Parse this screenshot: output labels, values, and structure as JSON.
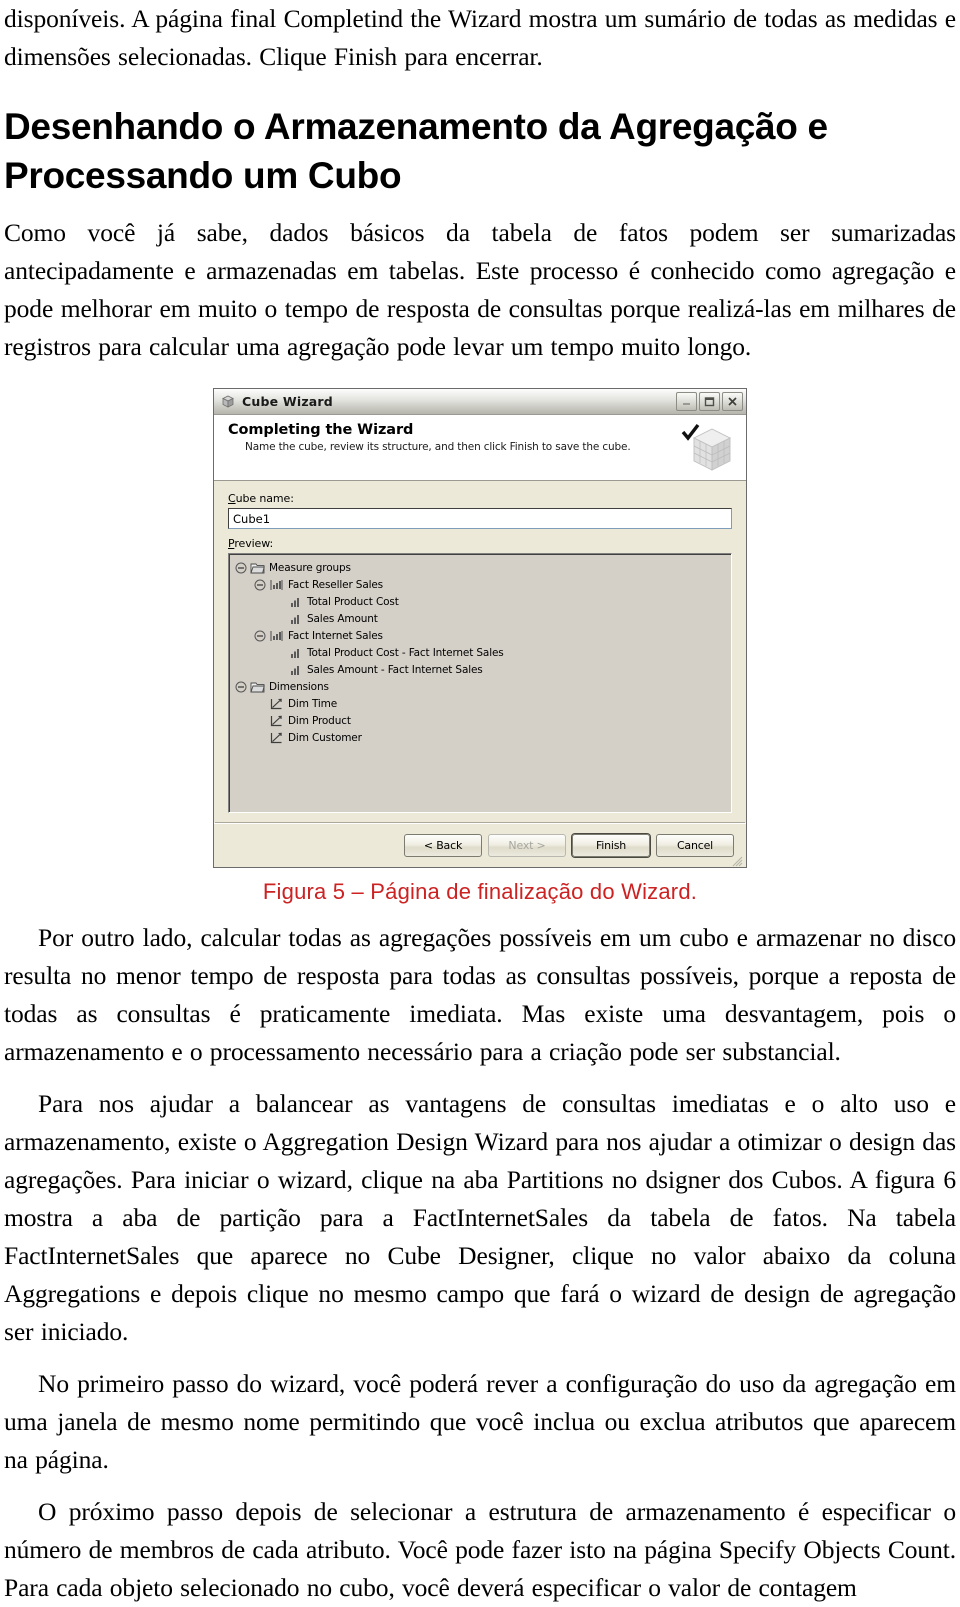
{
  "document": {
    "intro_paragraph": "disponíveis.  A página final Completind  the  Wizard  mostra  um sumário  de todas  as medidas  e dimensões  selecionadas.  Clique  Finish  para encerrar.",
    "section_heading": "Desenhando o Armazenamento da Agregação e Processando um Cubo",
    "paragraph_1": "Como  você  já  sabe,  dados  básicos  da  tabela  de  fatos  podem  ser  sumarizadas antecipadamente  e armazenadas  em tabelas. Este processo é conhecido como agregação e pode  melhorar  em muito  o tempo  de resposta  de consultas  porque  realizá-las  em milhares  de registros  para calcular  uma agregação pode levar  um tempo  muito  longo.",
    "figure_caption": "Figura  5 – Página de finalização do Wizard.",
    "paragraph_2": "Por outro lado, calcular  todas as agregações possíveis  em um cubo e armazenar  no disco  resulta  no  menor  tempo  de  resposta  para todas  as consultas  possíveis,  porque a reposta de todas as consultas  é praticamente  imediata.  Mas existe uma desvantagem,  pois o armazenamento  e o processamento  necessário  para a criação pode ser substancial.",
    "paragraph_3": "Para  nos  ajudar  a balancear  as  vantagens  de consultas  imediatas  e o alto  uso  e armazenamento,  existe o Aggregation Design Wizard para nos ajudar a otimizar  o design das agregações. Para iniciar  o wizard,  clique  na aba Partitions  no dsigner  dos Cubos. A figura  6 mostra  a aba de partição  para a FactInternetSales  da tabela de fatos. Na tabela FactInternetSales  que  aparece  no Cube Designer,  clique  no  valor  abaixo  da coluna Aggregations  e depois clique  no mesmo  campo que fará o wizard  de design  de agregação ser iniciado.",
    "paragraph_4": "No primeiro  passo do wizard,  você poderá rever  a configuração  do uso da agregação em uma  janela  de  mesmo  nome  permitindo  que  você  inclua  ou exclua  atributos  que aparecem na página.",
    "paragraph_5": "O próximo  passo depois de selecionar  a estrutura  de armazenamento  é especificar  o número  de membros  de cada atributo.  Você pode fazer  isto na página Specify  Objects Count. Para cada objeto selecionado  no cubo, você deverá especificar  o valor de contagem",
    "caption_color": "#cc2222"
  },
  "figure": {
    "dialog": {
      "titlebar": {
        "title": "Cube Wizard",
        "minimize_label": "Minimize",
        "maximize_label": "Maximize",
        "close_label": "Close"
      },
      "banner": {
        "heading": "Completing the Wizard",
        "subheading": "Name the cube, review its structure, and then click Finish to save the cube."
      },
      "cube_name": {
        "label": "Cube name:",
        "value": "Cube1"
      },
      "preview": {
        "label": "Preview:",
        "tree": [
          {
            "depth": 0,
            "label": "Measure groups",
            "icon": "folder-icon",
            "expander": "minus"
          },
          {
            "depth": 1,
            "label": "Fact Reseller Sales",
            "icon": "measure-group-icon",
            "expander": "minus"
          },
          {
            "depth": 2,
            "label": "Total Product Cost",
            "icon": "measure-icon",
            "expander": "none"
          },
          {
            "depth": 2,
            "label": "Sales Amount",
            "icon": "measure-icon",
            "expander": "none"
          },
          {
            "depth": 1,
            "label": "Fact Internet Sales",
            "icon": "measure-group-icon",
            "expander": "minus"
          },
          {
            "depth": 2,
            "label": "Total Product Cost - Fact Internet Sales",
            "icon": "measure-icon",
            "expander": "none"
          },
          {
            "depth": 2,
            "label": "Sales Amount - Fact Internet Sales",
            "icon": "measure-icon",
            "expander": "none"
          },
          {
            "depth": 0,
            "label": "Dimensions",
            "icon": "folder-icon",
            "expander": "minus"
          },
          {
            "depth": 1,
            "label": "Dim Time",
            "icon": "dimension-icon",
            "expander": "none"
          },
          {
            "depth": 1,
            "label": "Dim Product",
            "icon": "dimension-icon",
            "expander": "none"
          },
          {
            "depth": 1,
            "label": "Dim Customer",
            "icon": "dimension-icon",
            "expander": "none"
          }
        ]
      },
      "buttons": {
        "back": "< Back",
        "next": "Next >",
        "finish": "Finish",
        "cancel": "Cancel"
      }
    }
  }
}
